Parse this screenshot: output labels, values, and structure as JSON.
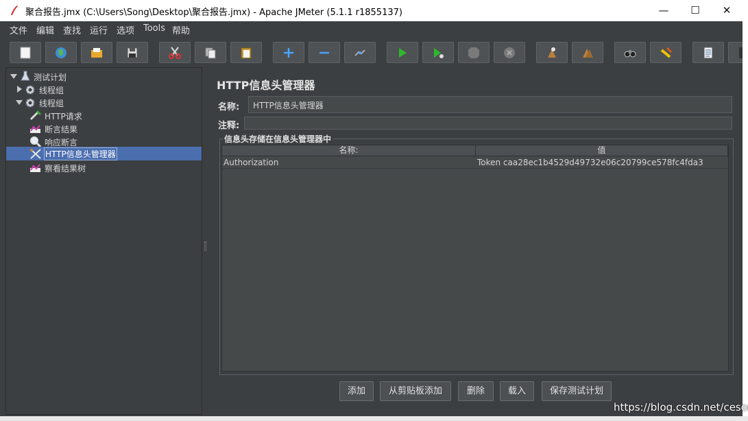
{
  "window": {
    "title": "聚合报告.jmx (C:\\Users\\Song\\Desktop\\聚合报告.jmx) - Apache JMeter (5.1.1 r1855137)",
    "minimize": "—",
    "maximize": "☐",
    "close": "✕"
  },
  "menu": [
    "文件",
    "编辑",
    "查找",
    "运行",
    "选项",
    "Tools",
    "帮助"
  ],
  "toolbar": {
    "buttons": [
      "new-icon",
      "templates-icon",
      "open-icon",
      "save-icon",
      "cut-icon",
      "copy-icon",
      "paste-icon",
      "expand-icon",
      "collapse-icon",
      "toggle-icon",
      "start-icon",
      "start-no-pause-icon",
      "stop-icon",
      "shutdown-icon",
      "clear-icon",
      "clear-all-icon",
      "search-icon",
      "reset-search-icon",
      "function-helper-icon",
      "help-icon"
    ]
  },
  "tree": {
    "nodes": [
      {
        "label": "测试计划",
        "icon": "flask-icon"
      },
      {
        "label": "线程组",
        "icon": "gear-icon"
      },
      {
        "label": "线程组",
        "icon": "gear-icon"
      },
      {
        "label": "HTTP请求",
        "icon": "pipette-icon"
      },
      {
        "label": "断言结果",
        "icon": "chart-icon"
      },
      {
        "label": "响应断言",
        "icon": "magnifier-icon"
      },
      {
        "label": "HTTP信息头管理器",
        "icon": "tools-icon"
      },
      {
        "label": "察看结果树",
        "icon": "chart-icon"
      }
    ]
  },
  "panel": {
    "title": "HTTP信息头管理器",
    "name_label": "名称:",
    "name_value": "HTTP信息头管理器",
    "comment_label": "注释:",
    "comment_value": "",
    "group_title": "信息头存储在信息头管理器中",
    "table": {
      "headers": [
        "名称:",
        "值"
      ],
      "rows": [
        [
          "Authorization",
          "Token caa28ec1b4529d49732e06c20799ce578fc4fda3"
        ]
      ]
    },
    "buttons": {
      "add": "添加",
      "add_clipboard": "从剪贴板添加",
      "delete": "删除",
      "load": "载入",
      "save_plan": "保存测试计划"
    }
  },
  "watermark": "https://blog.csdn.net/cesor"
}
